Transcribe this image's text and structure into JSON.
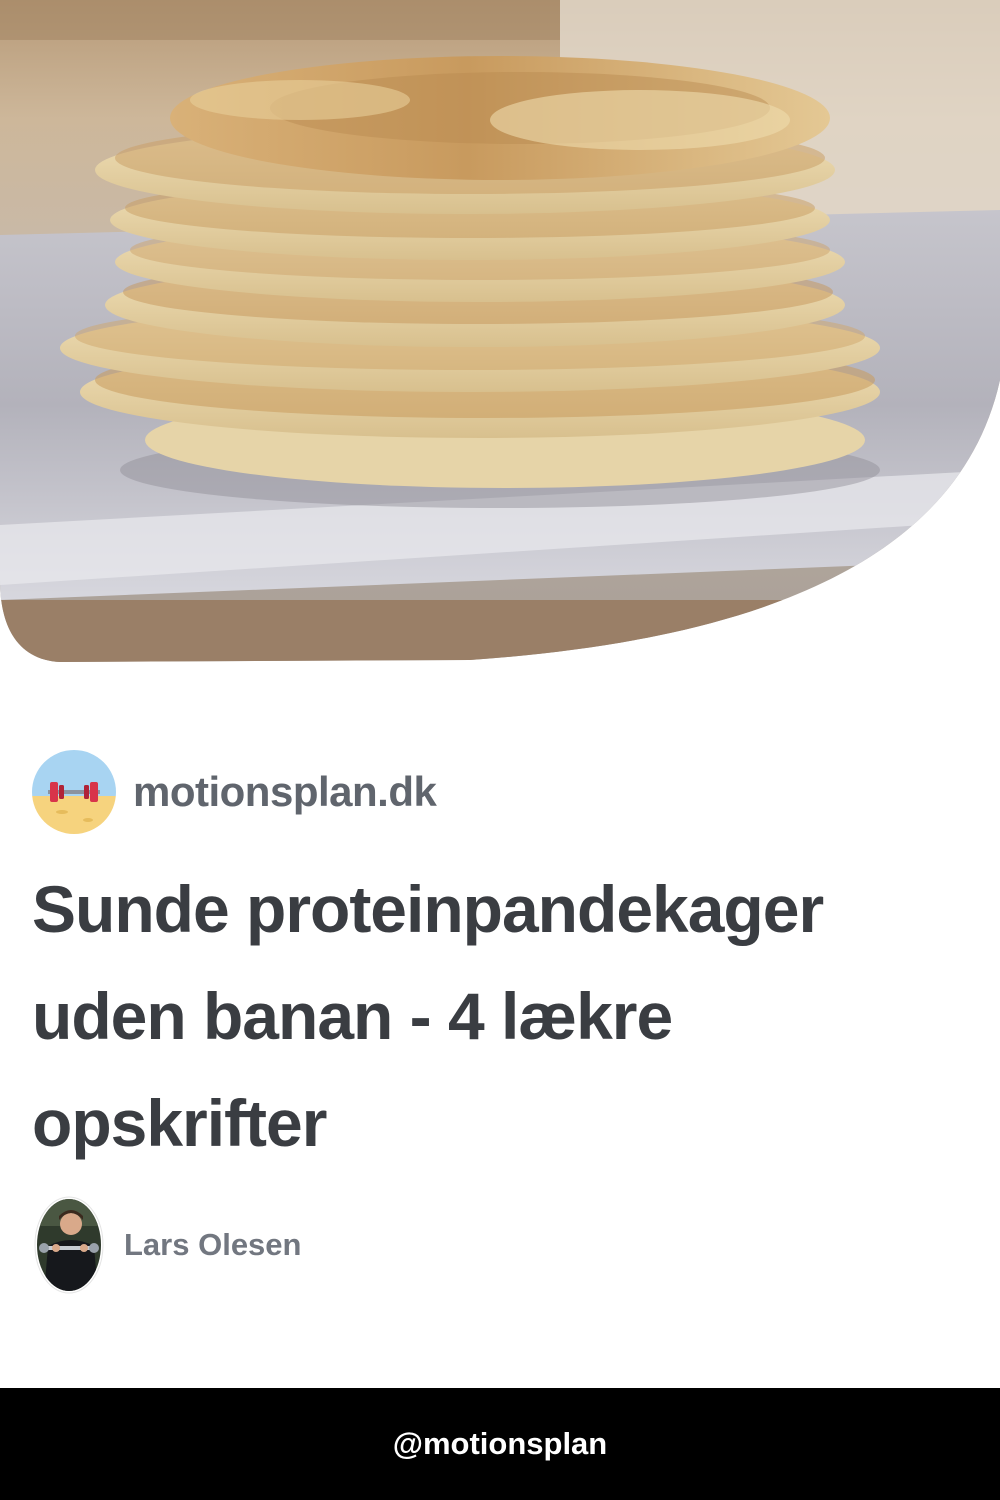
{
  "hero": {
    "image": "stack-of-protein-pancakes-photo"
  },
  "source": {
    "logo_icon": "dumbbell-beach-logo-icon",
    "site_name": "motionsplan.dk"
  },
  "article": {
    "title": "Sunde proteinpandekager uden banan - 4 lækre opskrifter"
  },
  "author": {
    "avatar_icon": "author-photo-avatar",
    "name": "Lars Olesen"
  },
  "footer": {
    "handle": "@motionsplan",
    "background": "#000000",
    "text_color": "#ffffff"
  },
  "colors": {
    "title": "#3a3d42",
    "site_name": "#60656d",
    "author_name": "#727780",
    "logo_sky": "#a8d4f2",
    "logo_sand": "#f6d37e",
    "dumbbell": "#d8344a"
  }
}
